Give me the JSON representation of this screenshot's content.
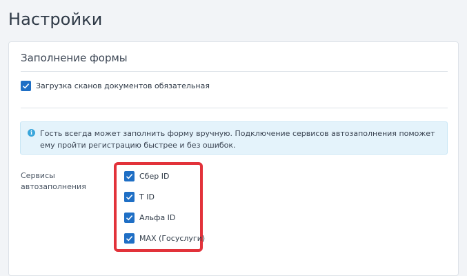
{
  "page": {
    "title": "Настройки"
  },
  "form_card": {
    "title": "Заполнение формы",
    "scan_required": {
      "label": "Загрузка сканов документов обязательная",
      "checked": true
    },
    "info": {
      "icon": "info-icon",
      "text": "Гость всегда может заполнить форму вручную. Подключение сервисов автозаполнения поможет ему пройти регистрацию быстрее и без ошибок."
    },
    "services": {
      "label": "Сервисы автозаполнения",
      "items": [
        {
          "label": "Сбер ID",
          "checked": true
        },
        {
          "label": "T ID",
          "checked": true
        },
        {
          "label": "Альфа ID",
          "checked": true
        },
        {
          "label": "MAX (Госуслуги)",
          "checked": true
        }
      ]
    }
  },
  "colors": {
    "checkbox": "#1f6fc5",
    "info_bg": "#e4f3fb",
    "highlight": "#e2323a"
  }
}
